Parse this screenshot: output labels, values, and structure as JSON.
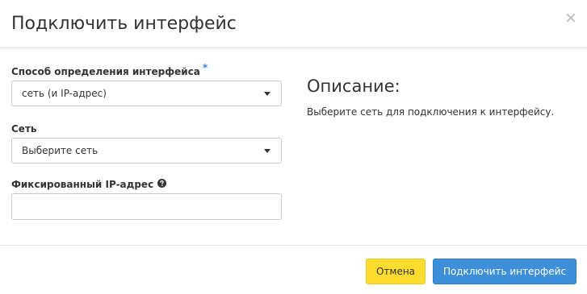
{
  "dialog": {
    "title": "Подключить интерфейс",
    "close_symbol": "×"
  },
  "form": {
    "interface_method": {
      "label": "Способ определения интерфейса",
      "required_mark": "*",
      "selected": "сеть (и IP-адрес)"
    },
    "network": {
      "label": "Сеть",
      "selected": "Выберите сеть"
    },
    "fixed_ip": {
      "label": "Фиксированный IP-адрес",
      "help_icon": "question-circle-icon",
      "value": ""
    }
  },
  "description": {
    "title": "Описание:",
    "text": "Выберите сеть для подключения к интерфейсу."
  },
  "footer": {
    "cancel_label": "Отмена",
    "submit_label": "Подключить интерфейс"
  },
  "colors": {
    "cancel_button": "#fedd2f",
    "primary_button": "#3d8fd9",
    "required_star": "#3a86d0"
  }
}
